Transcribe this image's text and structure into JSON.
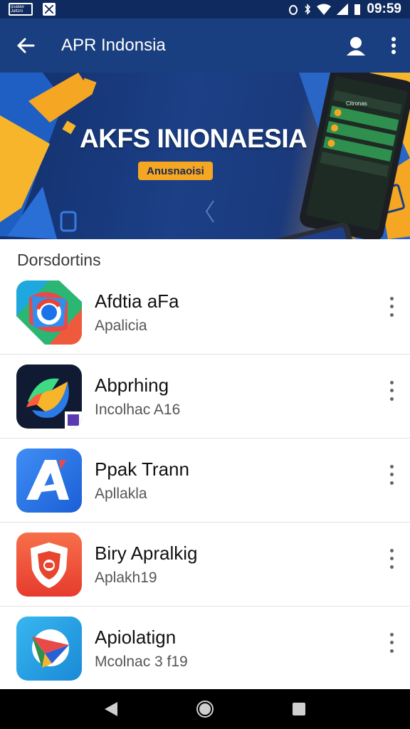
{
  "status_bar": {
    "time": "09:59",
    "left_icon_text": "ūsalaw Jaltzni"
  },
  "app_bar": {
    "title": "APR Indonsia"
  },
  "banner": {
    "title": "AKFS INIONAESIA",
    "button_label": "Anusnaoisi",
    "phone_header": "Citronas",
    "colors": {
      "navy": "#12306c",
      "orange": "#f5a623",
      "yellow": "#f7b52c",
      "green": "#2f8f4e"
    }
  },
  "section": {
    "title": "Dorsdortins"
  },
  "apps": [
    {
      "name": "Afdtia aFa",
      "subtitle": "Apalicia",
      "icon": "chrome-style-icon"
    },
    {
      "name": "Abprhing",
      "subtitle": "Incolhac A16",
      "icon": "swirl-icon"
    },
    {
      "name": "Ppak Trann",
      "subtitle": "Apllakla",
      "icon": "letter-a-icon"
    },
    {
      "name": "Biry Apralkig",
      "subtitle": "Aplakh19",
      "icon": "shield-icon"
    },
    {
      "name": "Apiolatign",
      "subtitle": "Mcolnac 3 f19",
      "icon": "paper-plane-icon"
    }
  ],
  "nav": {
    "back": "back-triangle-icon",
    "home": "home-circle-icon",
    "recents": "recents-square-icon"
  }
}
